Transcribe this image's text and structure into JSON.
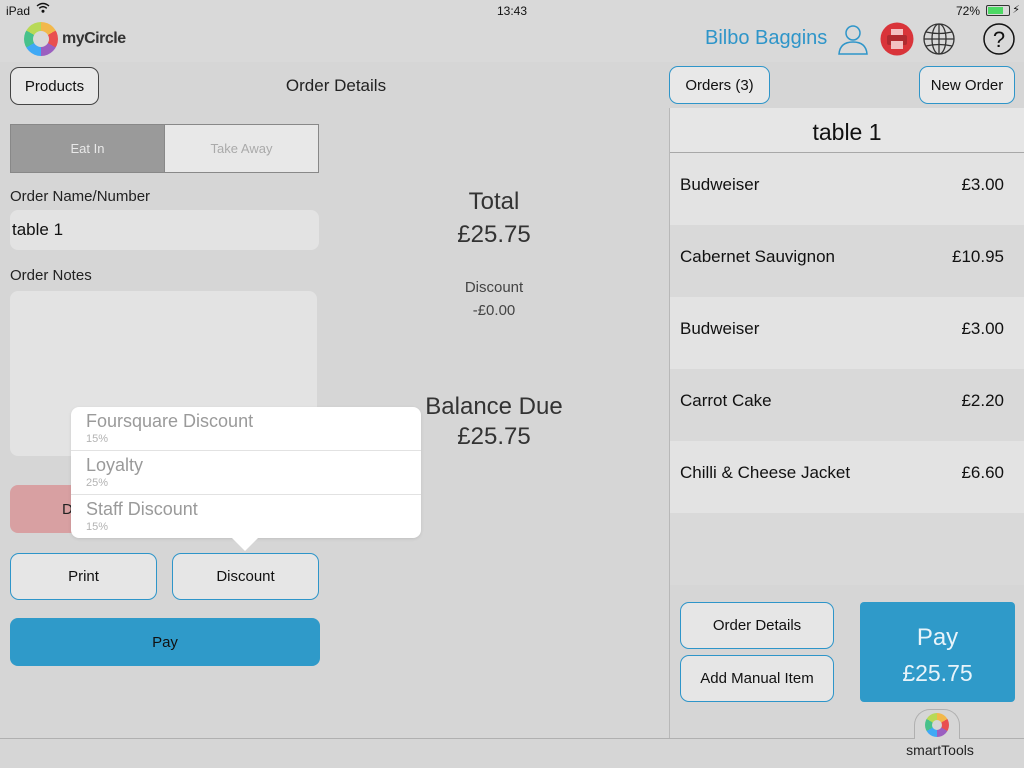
{
  "status_bar": {
    "device": "iPad",
    "time": "13:43",
    "battery": "72%",
    "battery_level": 0.72
  },
  "header": {
    "app_name": "myCircle",
    "user_name": "Bilbo Baggins",
    "icons": [
      "user-icon",
      "printer-icon",
      "globe-icon",
      "help-icon"
    ]
  },
  "nav": {
    "products_label": "Products",
    "title": "Order Details",
    "orders_label": "Orders (3)",
    "new_order_label": "New Order"
  },
  "order_type": {
    "options": [
      "Eat In",
      "Take Away"
    ],
    "selected": "Eat In"
  },
  "form": {
    "name_label": "Order Name/Number",
    "name_value": "table 1",
    "notes_label": "Order Notes",
    "notes_value": ""
  },
  "actions": {
    "partial_label": "D",
    "print_label": "Print",
    "discount_label": "Discount",
    "pay_label": "Pay"
  },
  "totals": {
    "total_label": "Total",
    "total_value": "£25.75",
    "discount_label": "Discount",
    "discount_value": "-£0.00",
    "balance_label": "Balance Due",
    "balance_value": "£25.75"
  },
  "discount_menu": [
    {
      "name": "Foursquare Discount",
      "percent": "15%"
    },
    {
      "name": "Loyalty",
      "percent": "25%"
    },
    {
      "name": "Staff Discount",
      "percent": "15%"
    }
  ],
  "order": {
    "title": "table 1",
    "items": [
      {
        "name": "Budweiser",
        "price": "£3.00"
      },
      {
        "name": "Cabernet Sauvignon",
        "price": "£10.95"
      },
      {
        "name": "Budweiser",
        "price": "£3.00"
      },
      {
        "name": "Carrot Cake",
        "price": "£2.20"
      },
      {
        "name": "Chilli & Cheese Jacket",
        "price": "£6.60"
      }
    ],
    "details_label": "Order Details",
    "manual_label": "Add Manual Item",
    "pay_label": "Pay",
    "pay_amount": "£25.75"
  },
  "footer": {
    "tools_label": "smartTools"
  },
  "colors": {
    "accent": "#2f9ac9",
    "user_name": "#2e95c9",
    "danger": "#d8a0a2",
    "printer": "#d9343a"
  }
}
